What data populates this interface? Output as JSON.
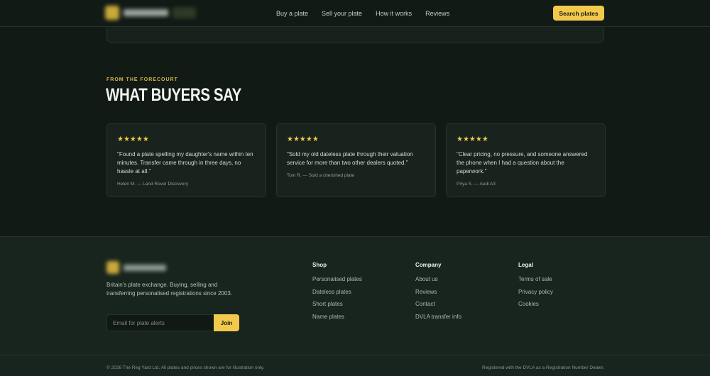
{
  "nav": {
    "links": [
      "Buy a plate",
      "Sell your plate",
      "How it works",
      "Reviews"
    ],
    "cta": "Search plates"
  },
  "testimonials": {
    "eyebrow": "FROM THE FORECOURT",
    "title": "WHAT BUYERS SAY",
    "items": [
      {
        "stars": "★★★★★",
        "quote": "\"Found a plate spelling my daughter's name within ten minutes. Transfer came through in three days, no hassle at all.\"",
        "author": "Helen M. — Land Rover Discovery"
      },
      {
        "stars": "★★★★★",
        "quote": "\"Sold my old dateless plate through their valuation service for more than two other dealers quoted.\"",
        "author": "Tom R. — Sold a cherished plate"
      },
      {
        "stars": "★★★★★",
        "quote": "\"Clear pricing, no pressure, and someone answered the phone when I had a question about the paperwork.\"",
        "author": "Priya S. — Audi A3"
      }
    ]
  },
  "footer": {
    "description": "Britain's plate exchange. Buying, selling and transferring personalised registrations since 2003.",
    "alert_placeholder": "Email for plate alerts",
    "join": "Join",
    "columns": [
      {
        "heading": "Shop",
        "links": [
          "Personalised plates",
          "Dateless plates",
          "Short plates",
          "Name plates"
        ]
      },
      {
        "heading": "Company",
        "links": [
          "About us",
          "Reviews",
          "Contact",
          "DVLA transfer info"
        ]
      },
      {
        "heading": "Legal",
        "links": [
          "Terms of sale",
          "Privacy policy",
          "Cookies"
        ]
      }
    ],
    "copyright": "© 2026 The Reg Yard Ltd. All plates and prices shown are for illustration only.",
    "registration": "Registered with the DVLA as a Registration Number Dealer."
  },
  "colors": {
    "accent": "#f2c94c",
    "background": "#111a15",
    "footer": "#18241e"
  }
}
